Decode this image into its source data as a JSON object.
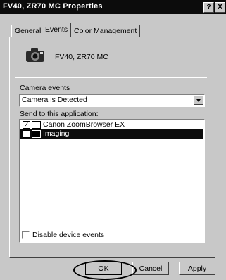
{
  "window": {
    "title": "FV40, ZR70 MC Properties",
    "help_glyph": "?",
    "close_glyph": "X"
  },
  "tabs": [
    {
      "label": "General"
    },
    {
      "label": "Events"
    },
    {
      "label": "Color Management"
    }
  ],
  "device": {
    "icon": "camera-icon",
    "name": "FV40, ZR70 MC"
  },
  "camera_events": {
    "label_pre": "Camera ",
    "label_ul": "e",
    "label_post": "vents",
    "selected": "Camera is Detected"
  },
  "send_to": {
    "label_ul": "S",
    "label_post": "end to this application:",
    "items": [
      {
        "checkbox_mark": "✓",
        "name": "Canon ZoomBrowser EX",
        "checked": true,
        "selected": false
      },
      {
        "checkbox_mark": "",
        "name": "Imaging",
        "checked": false,
        "selected": true
      }
    ]
  },
  "disable_events": {
    "label_ul": "D",
    "label_post": "isable device events",
    "checked": false
  },
  "buttons": {
    "ok": "OK",
    "cancel": "Cancel",
    "apply_ul": "A",
    "apply_post": "pply"
  },
  "colors": {
    "selection": "#0c0c0c",
    "face": "#c8c8c8"
  }
}
